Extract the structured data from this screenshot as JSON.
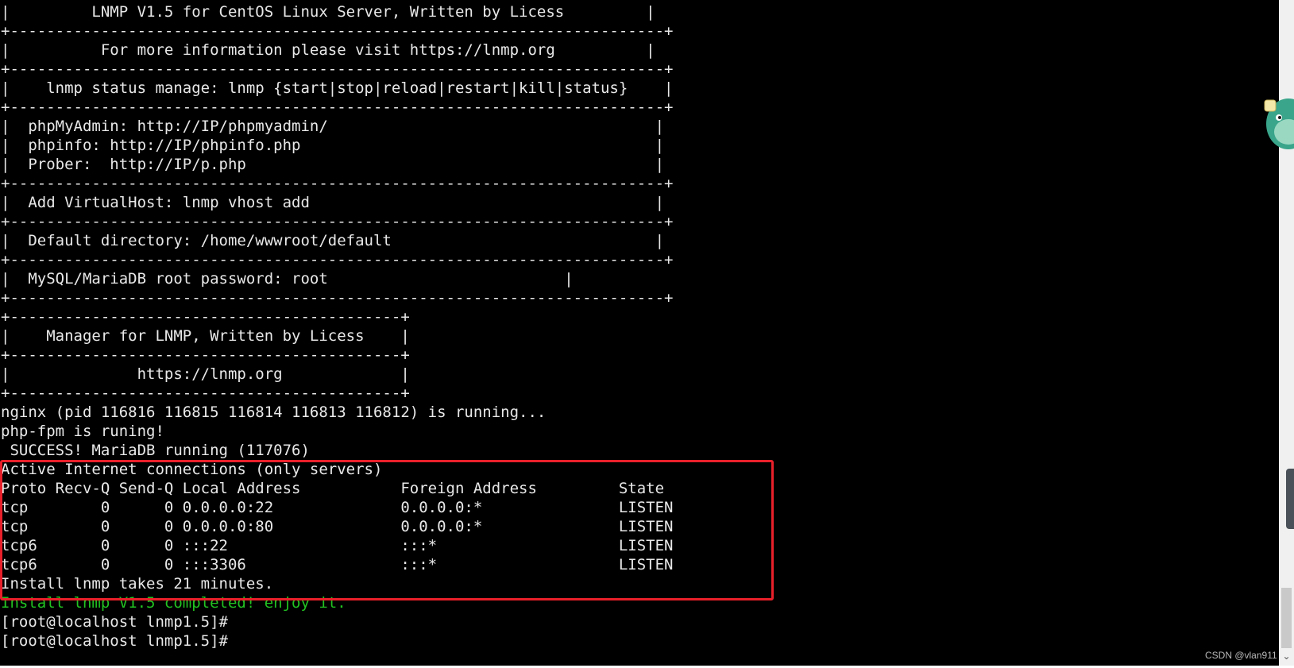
{
  "terminal": {
    "lines": [
      "|         LNMP V1.5 for CentOS Linux Server, Written by Licess         |",
      "+------------------------------------------------------------------------+",
      "|          For more information please visit https://lnmp.org          |",
      "+------------------------------------------------------------------------+",
      "|    lnmp status manage: lnmp {start|stop|reload|restart|kill|status}    |",
      "+------------------------------------------------------------------------+",
      "|  phpMyAdmin: http://IP/phpmyadmin/                                    |",
      "|  phpinfo: http://IP/phpinfo.php                                       |",
      "|  Prober:  http://IP/p.php                                             |",
      "+------------------------------------------------------------------------+",
      "|  Add VirtualHost: lnmp vhost add                                      |",
      "+------------------------------------------------------------------------+",
      "|  Default directory: /home/wwwroot/default                             |",
      "+------------------------------------------------------------------------+",
      "|  MySQL/MariaDB root password: root                          |",
      "+------------------------------------------------------------------------+",
      "",
      "+-------------------------------------------+",
      "|    Manager for LNMP, Written by Licess    |",
      "+-------------------------------------------+",
      "|              https://lnmp.org             |",
      "+-------------------------------------------+",
      "nginx (pid 116816 116815 116814 116813 116812) is running...",
      "php-fpm is runing!",
      " SUCCESS! MariaDB running (117076)",
      "Active Internet connections (only servers)",
      "Proto Recv-Q Send-Q Local Address           Foreign Address         State",
      "tcp        0      0 0.0.0.0:22              0.0.0.0:*               LISTEN",
      "tcp        0      0 0.0.0.0:80              0.0.0.0:*               LISTEN",
      "tcp6       0      0 :::22                   :::*                    LISTEN",
      "tcp6       0      0 :::3306                 :::*                    LISTEN",
      "Install lnmp takes 21 minutes.",
      "Install lnmp V1.5 completed! enjoy it.",
      "[root@localhost lnmp1.5]#",
      "[root@localhost lnmp1.5]#"
    ],
    "highlight_color": "#e8202a",
    "success_color": "#22c322",
    "text_color": "#e8e8e8",
    "background": "#000000"
  },
  "watermark": "CSDN @vlan911",
  "icons": {
    "mascot": "dinosaur-mascot-icon",
    "scroll_down": "chevron-down-icon"
  }
}
